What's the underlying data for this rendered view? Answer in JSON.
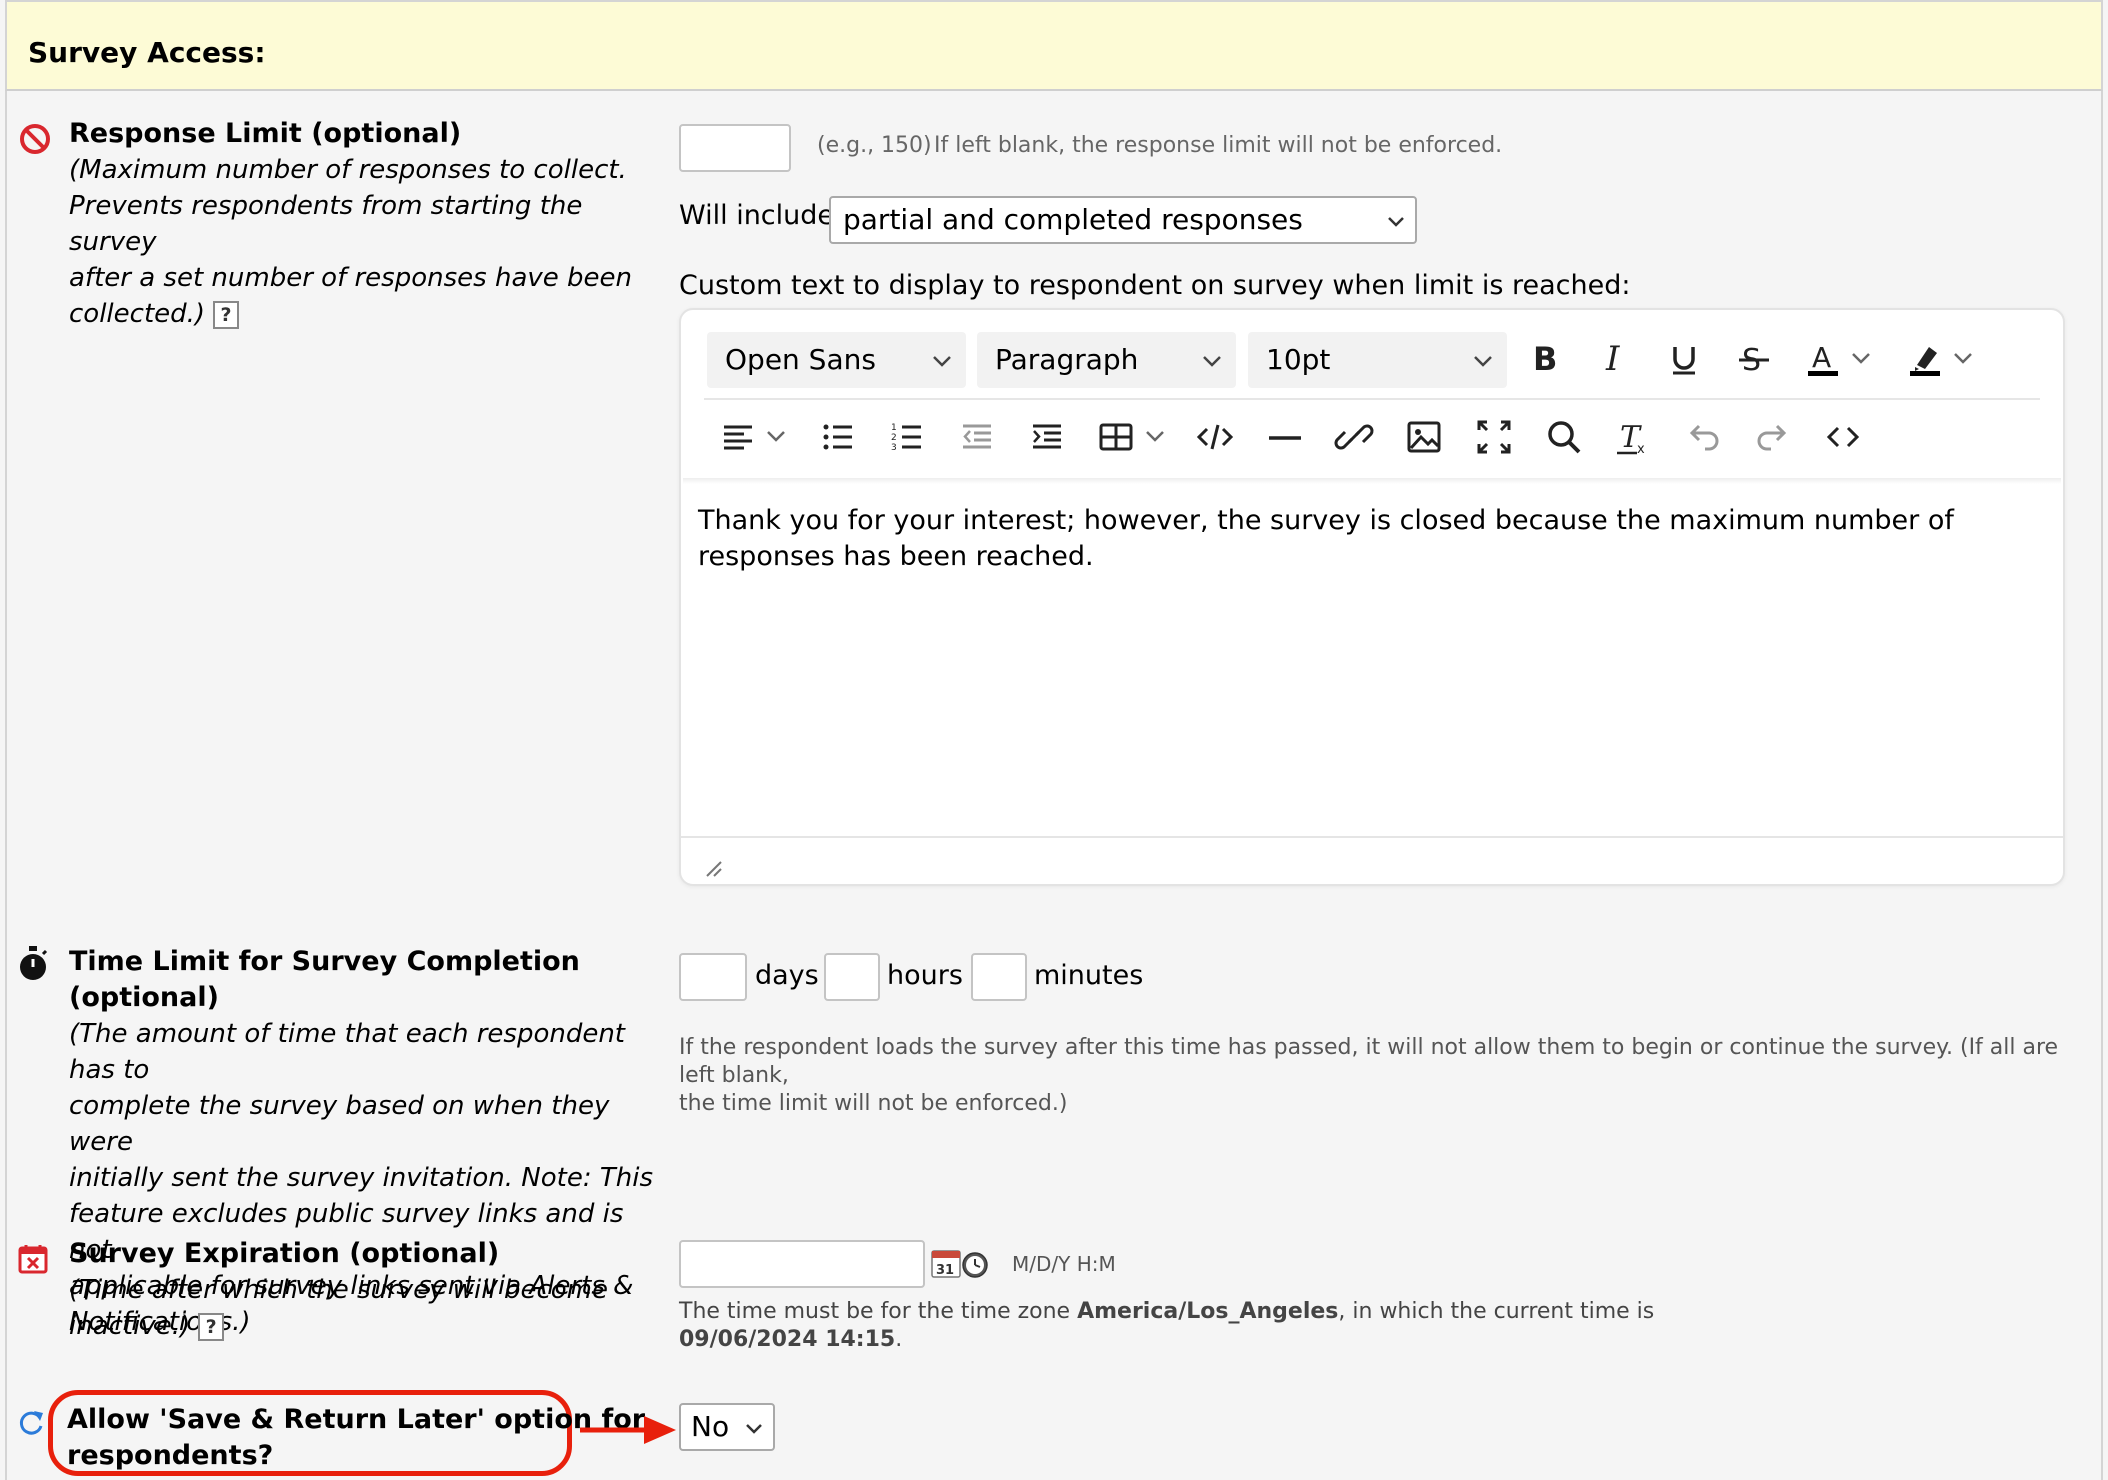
{
  "header": {
    "title": "Survey Access:"
  },
  "response_limit": {
    "title": "Response Limit (optional)",
    "desc_lines": [
      "(Maximum number of responses to collect.",
      "Prevents respondents from starting the survey",
      "after a set number of responses have been",
      "collected.)"
    ],
    "help_label": "?",
    "input_value": "",
    "example": "(e.g., 150)",
    "note": "If left blank, the response limit will not be enforced.",
    "will_include_label": "Will include",
    "will_include_value": "partial and completed responses",
    "custom_text_label": "Custom text to display to respondent on survey when limit is reached:"
  },
  "editor": {
    "font_family": "Open Sans",
    "block_format": "Paragraph",
    "font_size": "10pt",
    "content": "Thank you for your interest; however, the survey is closed because the maximum number of responses has been reached.",
    "row1_icons": [
      "bold-icon",
      "italic-icon",
      "underline-icon",
      "strikethrough-icon",
      "text-color-icon",
      "highlight-color-icon"
    ],
    "row2_icons": [
      "align-left-icon",
      "bullet-list-icon",
      "numbered-list-icon",
      "outdent-icon",
      "indent-icon",
      "table-icon",
      "code-sample-icon",
      "horizontal-rule-icon",
      "link-icon",
      "image-icon",
      "fullscreen-icon",
      "search-icon",
      "clear-format-icon",
      "undo-icon",
      "redo-icon",
      "source-code-icon"
    ]
  },
  "time_limit": {
    "title": "Time Limit for Survey Completion (optional)",
    "desc_lines": [
      "(The amount of time that each respondent has to",
      "complete the survey based on when they were",
      "initially sent the survey invitation. Note: This",
      "feature excludes public survey links and is not",
      "applicable for survey links sent via Alerts &",
      "Notifications.)"
    ],
    "days_label": "days",
    "hours_label": "hours",
    "minutes_label": "minutes",
    "days_value": "",
    "hours_value": "",
    "minutes_value": "",
    "note_line1": "If the respondent loads the survey after this time has passed, it will not allow them to begin or continue the survey. (If all are left blank,",
    "note_line2": "the time limit will not be enforced.)"
  },
  "expiration": {
    "title": "Survey Expiration (optional)",
    "desc_lines": [
      "(Time after which the survey will become",
      "inactive.)"
    ],
    "help_label": "?",
    "input_value": "",
    "format_hint": "M/D/Y H:M",
    "calendar_day": "31",
    "tz_prefix": "The time must be for the time zone ",
    "tz_name": "America/Los_Angeles",
    "tz_suffix": ", in which the current time is",
    "current_time": "09/06/2024 14:15",
    "period": "."
  },
  "save_return": {
    "title_line1": "Allow 'Save & Return Later' option for",
    "title_line2": "respondents?",
    "value": "No"
  },
  "colors": {
    "header_bg": "#fdfbd6",
    "annotation": "#e8200c",
    "blocked_icon": "#d9272e"
  }
}
